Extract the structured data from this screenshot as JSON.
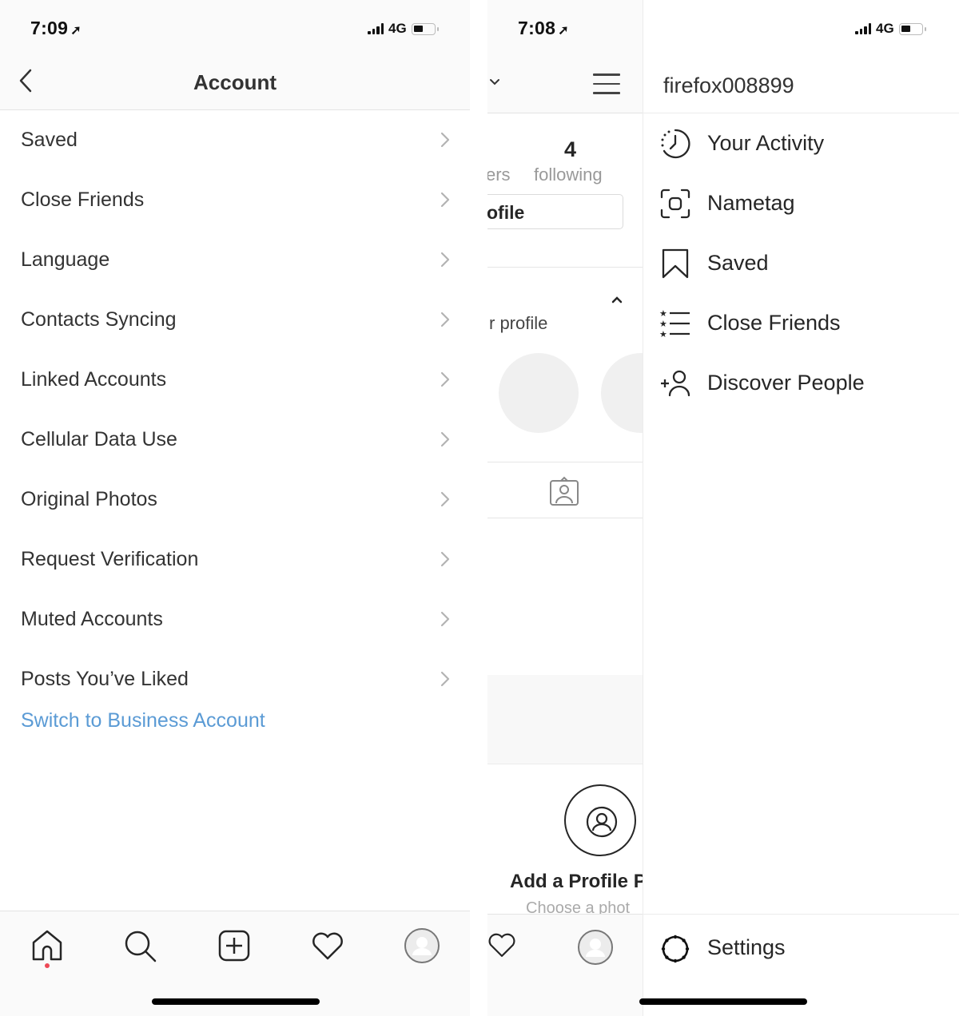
{
  "left_screen": {
    "status_bar": {
      "time": "7:09",
      "network": "4G"
    },
    "header": {
      "title": "Account",
      "back_icon": "chevron-left-icon"
    },
    "menu_items": [
      {
        "label": "Saved"
      },
      {
        "label": "Close Friends"
      },
      {
        "label": "Language"
      },
      {
        "label": "Contacts Syncing"
      },
      {
        "label": "Linked Accounts"
      },
      {
        "label": "Cellular Data Use"
      },
      {
        "label": "Original Photos"
      },
      {
        "label": "Request Verification"
      },
      {
        "label": "Muted Accounts"
      },
      {
        "label": "Posts You’ve Liked"
      }
    ],
    "business_link": "Switch to Business Account",
    "tab_bar": [
      "home-icon",
      "search-icon",
      "new-post-icon",
      "heart-icon",
      "profile-avatar"
    ],
    "colors": {
      "link": "#5b9bd5",
      "notification_dot": "#ed4956"
    }
  },
  "right_screen": {
    "status_bar": {
      "time": "7:08",
      "network": "4G"
    },
    "profile_peek": {
      "following_count": "4",
      "following_label": "following",
      "followers_label_partial": "ers",
      "edit_button_partial": "ofile",
      "section_text_partial": "r profile",
      "add_photo_title": "Add a Profile P",
      "add_photo_subtitle": "Choose a phot"
    },
    "drawer": {
      "username": "firefox008899",
      "items": [
        {
          "label": "Your Activity",
          "icon": "activity-icon"
        },
        {
          "label": "Nametag",
          "icon": "nametag-icon"
        },
        {
          "label": "Saved",
          "icon": "bookmark-icon"
        },
        {
          "label": "Close Friends",
          "icon": "close-friends-icon"
        },
        {
          "label": "Discover People",
          "icon": "add-person-icon"
        }
      ],
      "settings_label": "Settings"
    }
  }
}
